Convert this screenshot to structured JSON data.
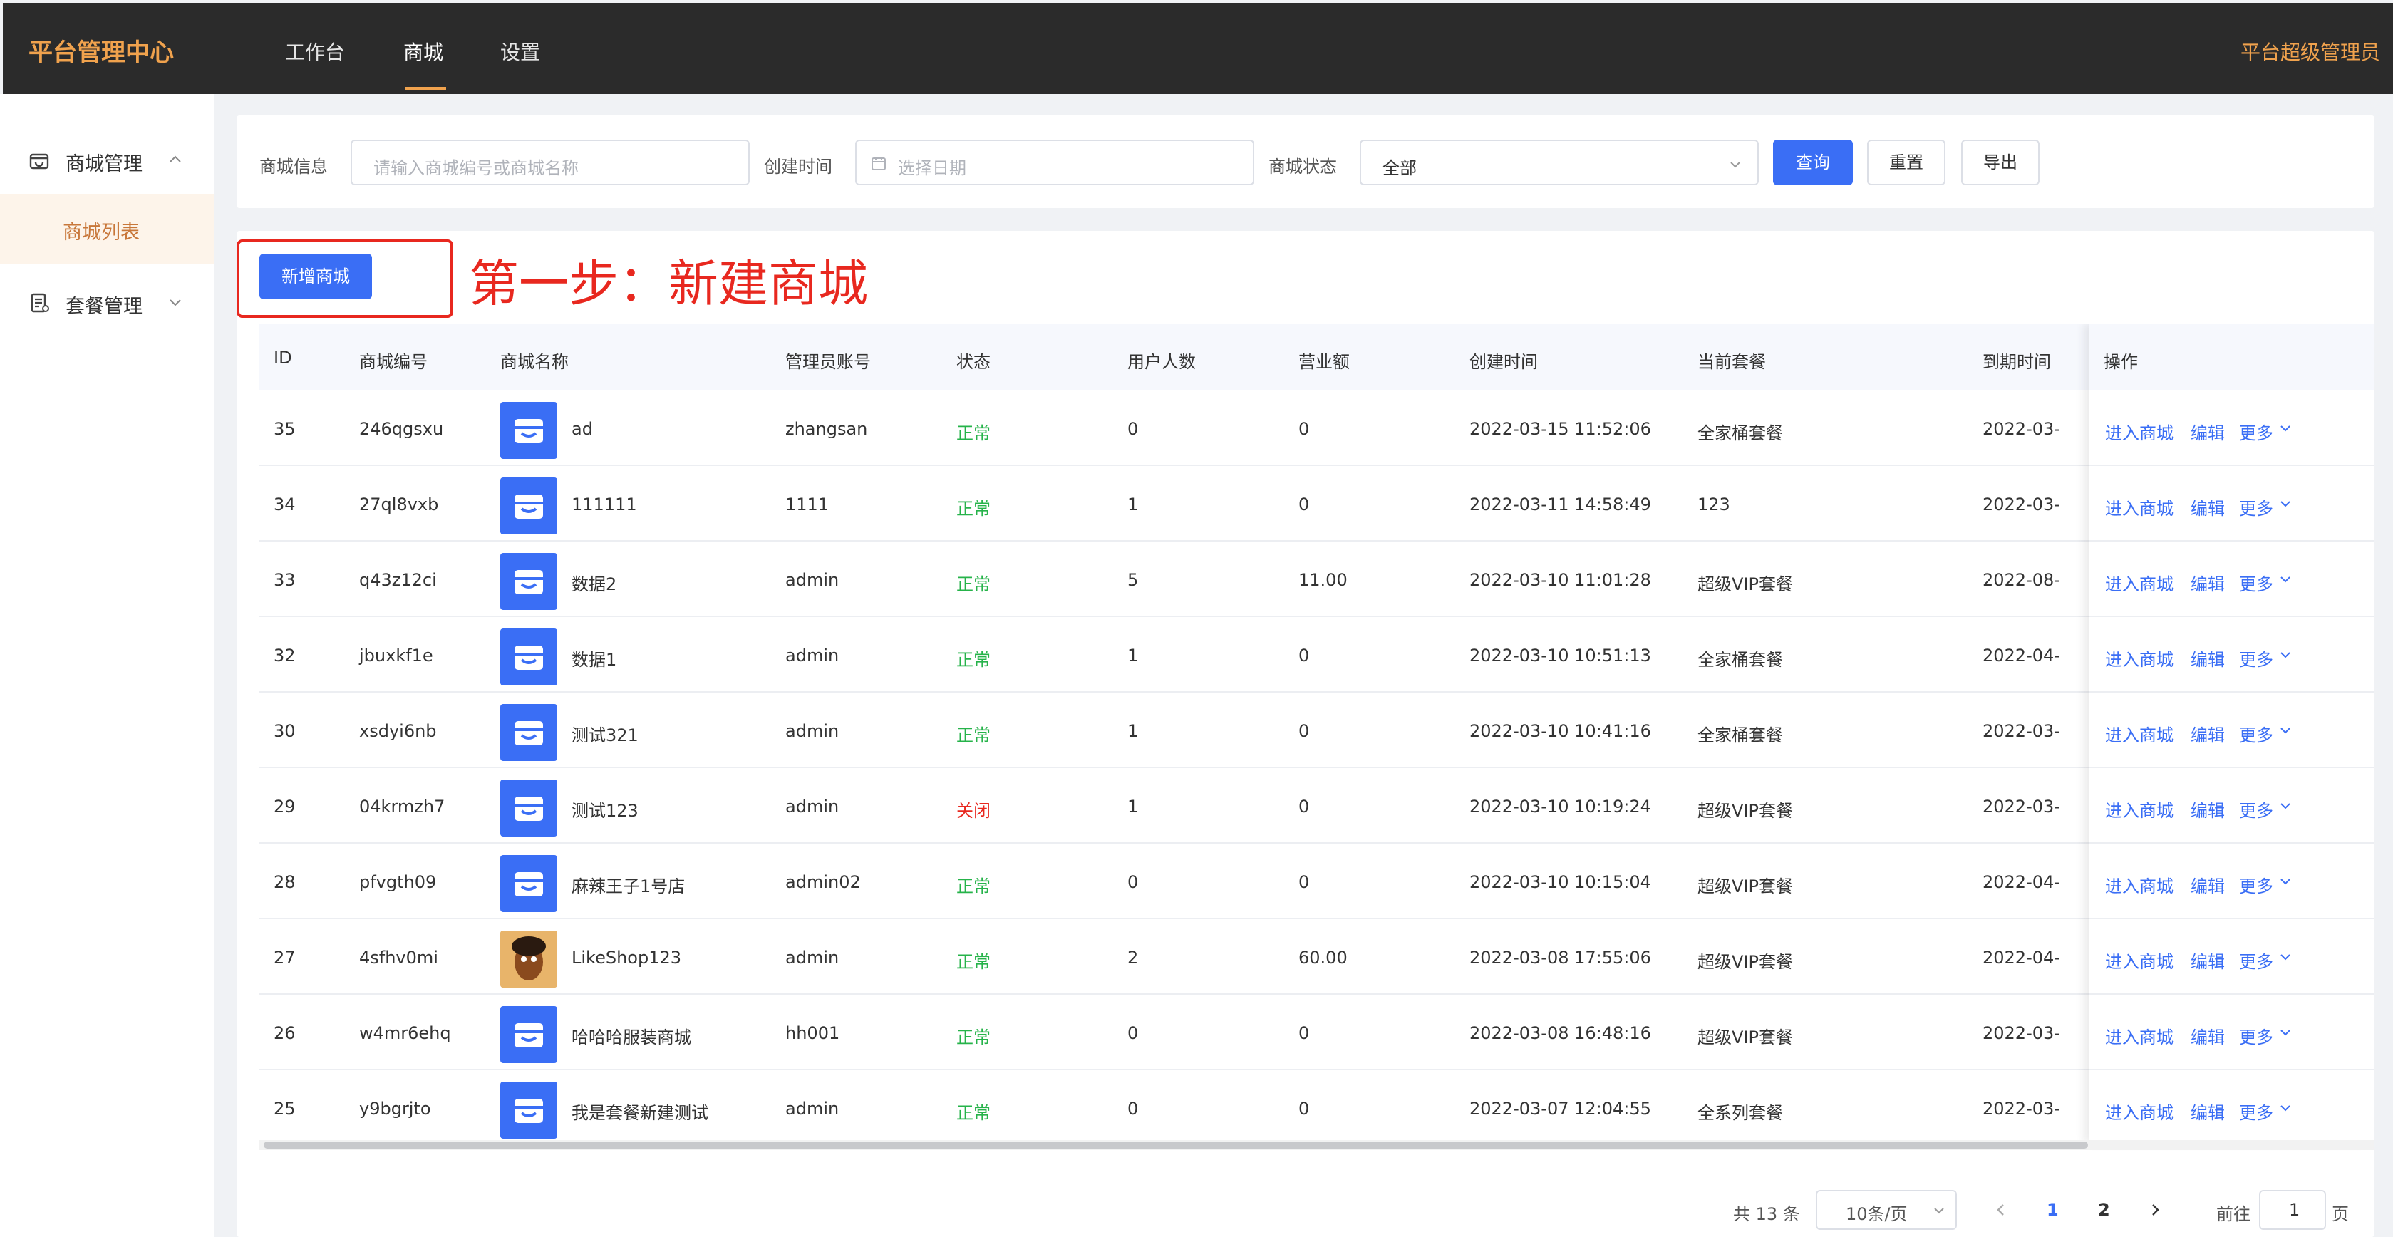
{
  "header": {
    "brand": "平台管理中心",
    "nav": [
      "工作台",
      "商城",
      "设置"
    ],
    "user": "平台超级管理员"
  },
  "sidebar": {
    "menu1": "商城管理",
    "submenu1": "商城列表",
    "menu2": "套餐管理"
  },
  "filters": {
    "label_info": "商城信息",
    "placeholder_info": "请输入商城编号或商城名称",
    "label_time": "创建时间",
    "placeholder_time": "选择日期",
    "label_status": "商城状态",
    "status_value": "全部",
    "btn_query": "查询",
    "btn_reset": "重置",
    "btn_export": "导出"
  },
  "actions": {
    "add_button": "新增商城",
    "annotation": "第一步：新建商城"
  },
  "table": {
    "headers": [
      "ID",
      "商城编号",
      "商城名称",
      "管理员账号",
      "状态",
      "用户人数",
      "营业额",
      "创建时间",
      "当前套餐",
      "到期时间",
      "操作"
    ],
    "op_enter": "进入商城",
    "op_edit": "编辑",
    "op_more": "更多",
    "rows": [
      {
        "id": "35",
        "code": "246qgsxu",
        "name": "ad",
        "admin": "zhangsan",
        "status": "正常",
        "users": "0",
        "revenue": "0",
        "created": "2022-03-15 11:52:06",
        "plan": "全家桶套餐",
        "expire": "2022-03-"
      },
      {
        "id": "34",
        "code": "27ql8vxb",
        "name": "111111",
        "admin": "1111",
        "status": "正常",
        "users": "1",
        "revenue": "0",
        "created": "2022-03-11 14:58:49",
        "plan": "123",
        "expire": "2022-03-"
      },
      {
        "id": "33",
        "code": "q43z12ci",
        "name": "数据2",
        "admin": "admin",
        "status": "正常",
        "users": "5",
        "revenue": "11.00",
        "created": "2022-03-10 11:01:28",
        "plan": "超级VIP套餐",
        "expire": "2022-08-"
      },
      {
        "id": "32",
        "code": "jbuxkf1e",
        "name": "数据1",
        "admin": "admin",
        "status": "正常",
        "users": "1",
        "revenue": "0",
        "created": "2022-03-10 10:51:13",
        "plan": "全家桶套餐",
        "expire": "2022-04-"
      },
      {
        "id": "30",
        "code": "xsdyi6nb",
        "name": "测试321",
        "admin": "admin",
        "status": "正常",
        "users": "1",
        "revenue": "0",
        "created": "2022-03-10 10:41:16",
        "plan": "全家桶套餐",
        "expire": "2022-03-"
      },
      {
        "id": "29",
        "code": "04krmzh7",
        "name": "测试123",
        "admin": "admin",
        "status": "关闭",
        "users": "1",
        "revenue": "0",
        "created": "2022-03-10 10:19:24",
        "plan": "超级VIP套餐",
        "expire": "2022-03-"
      },
      {
        "id": "28",
        "code": "pfvgth09",
        "name": "麻辣王子1号店",
        "admin": "admin02",
        "status": "正常",
        "users": "0",
        "revenue": "0",
        "created": "2022-03-10 10:15:04",
        "plan": "超级VIP套餐",
        "expire": "2022-04-"
      },
      {
        "id": "27",
        "code": "4sfhv0mi",
        "name": "LikeShop123",
        "admin": "admin",
        "status": "正常",
        "users": "2",
        "revenue": "60.00",
        "created": "2022-03-08 17:55:06",
        "plan": "超级VIP套餐",
        "expire": "2022-04-"
      },
      {
        "id": "26",
        "code": "w4mr6ehq",
        "name": "哈哈哈服装商城",
        "admin": "hh001",
        "status": "正常",
        "users": "0",
        "revenue": "0",
        "created": "2022-03-08 16:48:16",
        "plan": "超级VIP套餐",
        "expire": "2022-03-"
      },
      {
        "id": "25",
        "code": "y9bgrjto",
        "name": "我是套餐新建测试",
        "admin": "admin",
        "status": "正常",
        "users": "0",
        "revenue": "0",
        "created": "2022-03-07 12:04:55",
        "plan": "全系列套餐",
        "expire": "2022-03-"
      }
    ]
  },
  "pagination": {
    "total": "共 13 条",
    "page_size": "10条/页",
    "page1": "1",
    "page2": "2",
    "goto": "前往",
    "goto_value": "1",
    "page_unit": "页"
  }
}
